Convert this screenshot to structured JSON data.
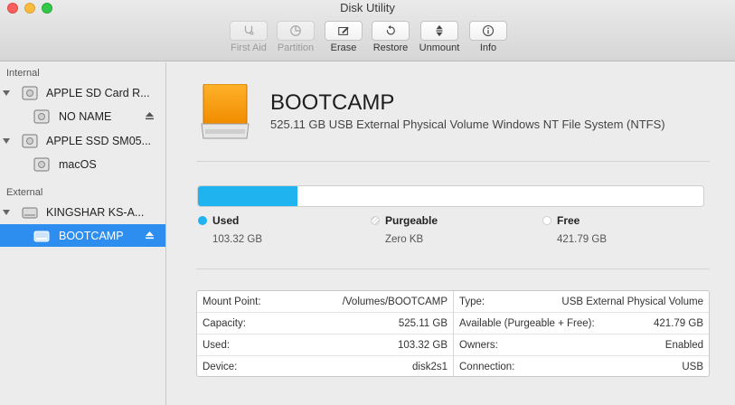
{
  "window": {
    "title": "Disk Utility"
  },
  "toolbar": {
    "buttons": [
      {
        "label": "First Aid",
        "icon": "stethoscope-icon",
        "enabled": false
      },
      {
        "label": "Partition",
        "icon": "pie-chart-icon",
        "enabled": false
      },
      {
        "label": "Erase",
        "icon": "erase-icon",
        "enabled": true
      },
      {
        "label": "Restore",
        "icon": "restore-icon",
        "enabled": true
      },
      {
        "label": "Unmount",
        "icon": "unmount-icon",
        "enabled": true
      },
      {
        "label": "Info",
        "icon": "info-icon",
        "enabled": true
      }
    ]
  },
  "sidebar": {
    "sections": [
      {
        "label": "Internal"
      },
      {
        "label": "External"
      }
    ],
    "items": [
      {
        "label": "APPLE SD Card R...",
        "icon": "internal-disk-icon"
      },
      {
        "label": "NO NAME",
        "icon": "internal-volume-icon",
        "eject": true
      },
      {
        "label": "APPLE SSD SM05...",
        "icon": "internal-disk-icon"
      },
      {
        "label": "macOS",
        "icon": "internal-volume-icon"
      },
      {
        "label": "KINGSHAR KS-A...",
        "icon": "external-disk-icon"
      },
      {
        "label": "BOOTCAMP",
        "icon": "external-volume-icon",
        "eject": true,
        "selected": true
      }
    ]
  },
  "volume": {
    "name": "BOOTCAMP",
    "description": "525.11 GB USB External Physical Volume Windows NT File System (NTFS)",
    "icon": "orange-drive-icon"
  },
  "usage": {
    "used_fraction": 0.1968,
    "used_color": "#1fb4f0",
    "legend": [
      {
        "title": "Used",
        "value": "103.32 GB",
        "color": "#1fb4f0"
      },
      {
        "title": "Purgeable",
        "value": "Zero KB",
        "color": "#ffffff"
      },
      {
        "title": "Free",
        "value": "421.79 GB",
        "color": "#ffffff"
      }
    ]
  },
  "info": {
    "left": [
      {
        "key": "Mount Point:",
        "value": "/Volumes/BOOTCAMP"
      },
      {
        "key": "Capacity:",
        "value": "525.11 GB"
      },
      {
        "key": "Used:",
        "value": "103.32 GB"
      },
      {
        "key": "Device:",
        "value": "disk2s1"
      }
    ],
    "right": [
      {
        "key": "Type:",
        "value": "USB External Physical Volume"
      },
      {
        "key": "Available (Purgeable + Free):",
        "value": "421.79 GB"
      },
      {
        "key": "Owners:",
        "value": "Enabled"
      },
      {
        "key": "Connection:",
        "value": "USB"
      }
    ]
  }
}
